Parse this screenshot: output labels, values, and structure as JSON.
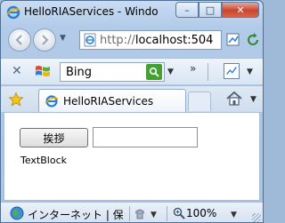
{
  "window": {
    "title": "HelloRIAServices - Windo",
    "minimize_glyph": "–",
    "maximize_glyph": "□",
    "close_glyph": "✕"
  },
  "address_bar": {
    "scheme": "http://",
    "host": "localhost",
    "port_fragment": ":504"
  },
  "search_bar": {
    "placeholder": "Bing",
    "chevron": "»"
  },
  "tabs": {
    "items": [
      {
        "label": "HelloRIAServices"
      }
    ]
  },
  "page": {
    "greet_button_label": "挨拶",
    "text_input_value": "",
    "textblock_text": "TextBlock"
  },
  "status_bar": {
    "zone_text": "インターネット | 保",
    "zoom_text": "100%"
  },
  "icons": {
    "back": "back-arrow-icon",
    "forward": "forward-arrow-icon",
    "page": "ie-page-icon",
    "favorites": "favorites-star-icon",
    "home": "home-icon",
    "globe": "globe-icon",
    "zoom": "zoom-magnifier-icon"
  },
  "colors": {
    "frame": "#b2cbe8",
    "close_button": "#c7462e",
    "search_go": "#45a033"
  }
}
